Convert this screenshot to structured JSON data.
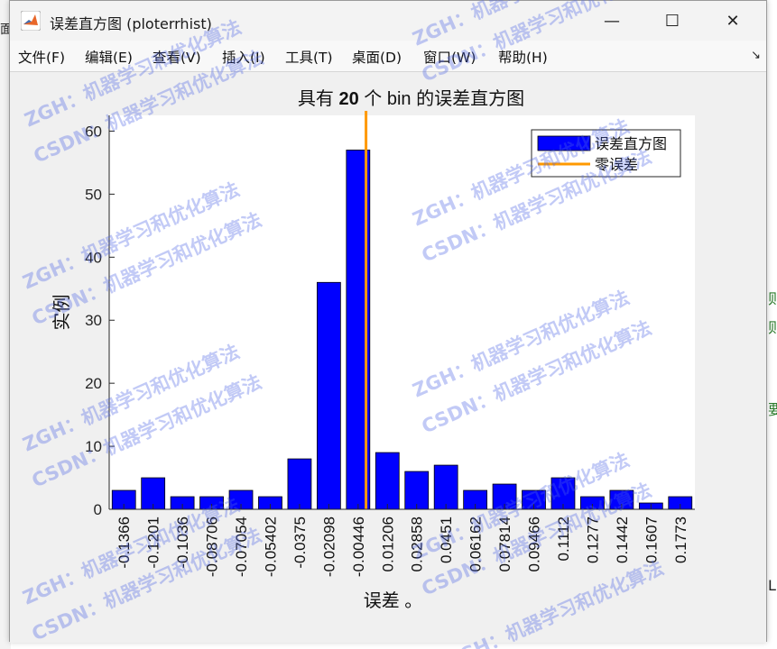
{
  "window": {
    "title": "误差直方图 (ploterrhist)",
    "buttons": {
      "minimize": "—",
      "maximize": "☐",
      "close": "✕"
    }
  },
  "menu": [
    {
      "label": "文件(F)"
    },
    {
      "label": "编辑(E)"
    },
    {
      "label": "查看(V)"
    },
    {
      "label": "插入(I)"
    },
    {
      "label": "工具(T)"
    },
    {
      "label": "桌面(D)"
    },
    {
      "label": "窗口(W)"
    },
    {
      "label": "帮助(H)"
    }
  ],
  "dock_icon": "↘",
  "background_fragments": [
    "面",
    "则",
    "则",
    "要",
    "L"
  ],
  "watermark": {
    "line1": "ZGH：机器学习和优化算法",
    "line2": "CSDN：机器学习和优化算法"
  },
  "colors": {
    "bar": "#0000ff",
    "zero_line": "#ff9900",
    "axes_bg": "#ffffff",
    "figure_bg": "#f0f0f0"
  },
  "chart_data": {
    "type": "bar",
    "title": "具有 20 个 bin 的误差直方图",
    "title_bold_part": "20",
    "xlabel": "误差 。",
    "ylabel": "实例",
    "categories": [
      "-0.1366",
      "-0.1201",
      "-0.1036",
      "-0.08706",
      "-0.07054",
      "-0.05402",
      "-0.0375",
      "-0.02098",
      "-0.00446",
      "0.01206",
      "0.02858",
      "0.0451",
      "0.06162",
      "0.07814",
      "0.09466",
      "0.1112",
      "0.1277",
      "0.1442",
      "0.1607",
      "0.1773"
    ],
    "series": [
      {
        "name": "误差直方图",
        "values": [
          3,
          5,
          2,
          2,
          3,
          2,
          8,
          36,
          57,
          9,
          6,
          7,
          3,
          4,
          3,
          5,
          2,
          3,
          1,
          2
        ]
      }
    ],
    "reference_line": {
      "name": "零误差",
      "x_value": 0
    },
    "yticks": [
      0,
      10,
      20,
      30,
      40,
      50,
      60
    ],
    "ylim": [
      0,
      62.5
    ],
    "grid": false,
    "legend_position": "top-right"
  }
}
